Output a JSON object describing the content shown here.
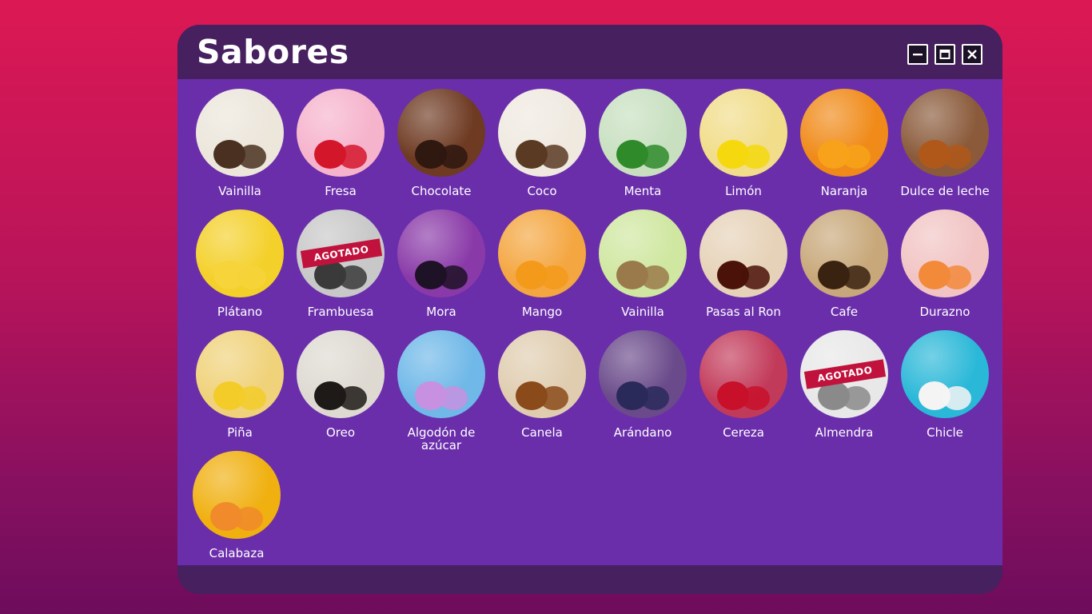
{
  "window": {
    "title": "Sabores",
    "controls": [
      "minimize-icon",
      "maximize-icon",
      "close-icon"
    ]
  },
  "sold_out_label": "AGOTADO",
  "flavors": [
    {
      "name": "Vainilla",
      "sold_out": false,
      "base": "#ece6db",
      "accent": "#4a3020"
    },
    {
      "name": "Fresa",
      "sold_out": false,
      "base": "#f6b3cc",
      "accent": "#d4162a"
    },
    {
      "name": "Chocolate",
      "sold_out": false,
      "base": "#6e3a22",
      "accent": "#2e1810"
    },
    {
      "name": "Coco",
      "sold_out": false,
      "base": "#efe9e0",
      "accent": "#5a3a22"
    },
    {
      "name": "Menta",
      "sold_out": false,
      "base": "#c8e0c0",
      "accent": "#2f8a2a"
    },
    {
      "name": "Limón",
      "sold_out": false,
      "base": "#f1dd8a",
      "accent": "#f5d80e"
    },
    {
      "name": "Naranja",
      "sold_out": false,
      "base": "#f08a18",
      "accent": "#f7a21a"
    },
    {
      "name": "Dulce de leche",
      "sold_out": false,
      "base": "#8a5a3a",
      "accent": "#b0581a"
    },
    {
      "name": "Plátano",
      "sold_out": false,
      "base": "#f4d02a",
      "accent": "#f6d43a"
    },
    {
      "name": "Frambuesa",
      "sold_out": true,
      "base": "#c8c8c8",
      "accent": "#3a3a3a"
    },
    {
      "name": "Mora",
      "sold_out": false,
      "base": "#8a3aa8",
      "accent": "#1e1226"
    },
    {
      "name": "Mango",
      "sold_out": false,
      "base": "#f4a640",
      "accent": "#f39a1a"
    },
    {
      "name": "Vainilla",
      "sold_out": false,
      "base": "#cfe7a0",
      "accent": "#9a7a4a"
    },
    {
      "name": "Pasas al Ron",
      "sold_out": false,
      "base": "#e6d2b8",
      "accent": "#4a1208"
    },
    {
      "name": "Cafe",
      "sold_out": false,
      "base": "#c8a87a",
      "accent": "#3a2210"
    },
    {
      "name": "Durazno",
      "sold_out": false,
      "base": "#f2c4c4",
      "accent": "#f28a3a"
    },
    {
      "name": "Piña",
      "sold_out": false,
      "base": "#f0d27a",
      "accent": "#f3cc2a"
    },
    {
      "name": "Oreo",
      "sold_out": false,
      "base": "#dedad2",
      "accent": "#1e1a18"
    },
    {
      "name": "Algodón de azúcar",
      "sold_out": false,
      "base": "#6fb8e8",
      "accent": "#c890e0"
    },
    {
      "name": "Canela",
      "sold_out": false,
      "base": "#e0cdb0",
      "accent": "#8a4a1a"
    },
    {
      "name": "Arándano",
      "sold_out": false,
      "base": "#6a4a8a",
      "accent": "#2a2a5a"
    },
    {
      "name": "Cereza",
      "sold_out": false,
      "base": "#c23a5a",
      "accent": "#c8102a"
    },
    {
      "name": "Almendra",
      "sold_out": true,
      "base": "#e8e8e8",
      "accent": "#8a8a8a"
    },
    {
      "name": "Chicle",
      "sold_out": false,
      "base": "#2ab8d8",
      "accent": "#f4f4f4"
    },
    {
      "name": "Calabaza",
      "sold_out": false,
      "base": "#f0b010",
      "accent": "#f08a2a"
    }
  ]
}
